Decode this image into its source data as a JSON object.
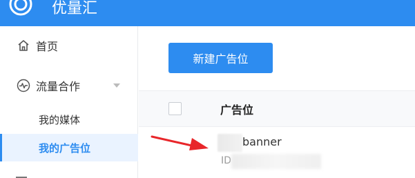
{
  "header": {
    "app_title": "优量汇"
  },
  "sidebar": {
    "home_label": "首页",
    "traffic_label": "流量合作",
    "sub_items": [
      {
        "label": "我的媒体"
      },
      {
        "label": "我的广告位"
      }
    ],
    "partial_label": "..."
  },
  "main": {
    "new_adspace_button": "新建广告位",
    "table": {
      "column_header": "广告位",
      "rows": [
        {
          "name_suffix": "banner",
          "id_label": "ID"
        }
      ]
    }
  },
  "colors": {
    "primary": "#2d8cf0",
    "annotation_arrow": "#e8262a",
    "active_bg": "#eaf3ff"
  }
}
